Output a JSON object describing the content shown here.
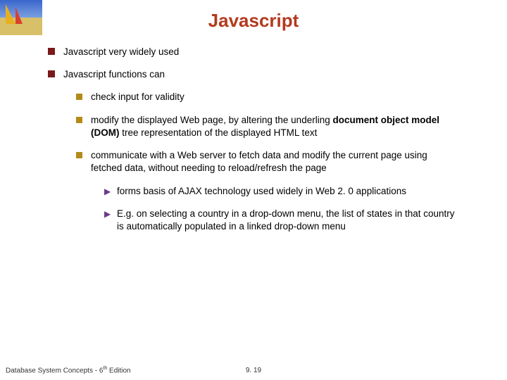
{
  "title": "Javascript",
  "items": {
    "p1": "Javascript very widely used",
    "p2": "Javascript functions can",
    "c1": "check input for validity",
    "c2a": "modify the displayed Web page, by altering the underling ",
    "c2b": "document object model (DOM)",
    "c2c": " tree representation of the displayed HTML text",
    "c3": "communicate with a Web server to fetch data and modify the current page using fetched data, without needing to reload/refresh the page",
    "d1": "forms basis of AJAX technology used widely in Web 2. 0 applications",
    "d2": "E.g. on selecting a country in a drop-down menu, the list of states in that country is automatically populated in a linked drop-down menu"
  },
  "footer": {
    "left_a": "Database System Concepts - 6",
    "left_sup": "th",
    "left_b": " Edition",
    "center": "9. 19"
  }
}
